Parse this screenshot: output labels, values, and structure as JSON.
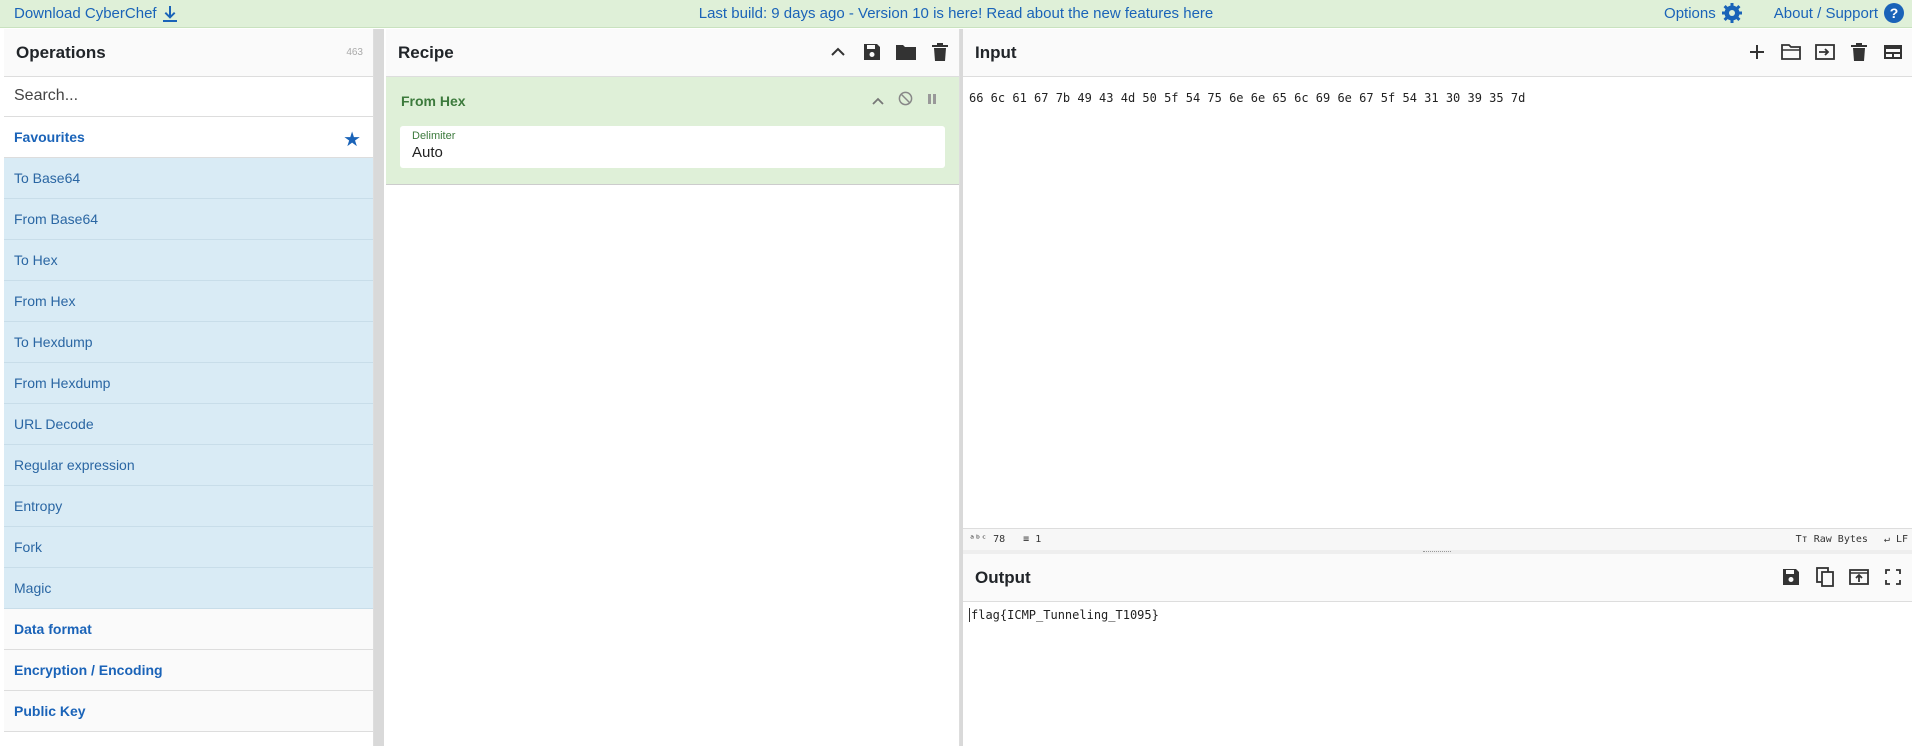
{
  "banner": {
    "download": "Download CyberChef",
    "build": "Last build: 9 days ago - Version 10 is here! Read about the new features here",
    "options": "Options",
    "about": "About / Support"
  },
  "operations": {
    "title": "Operations",
    "count": "463",
    "search_placeholder": "Search...",
    "favourites": "Favourites",
    "items": [
      "To Base64",
      "From Base64",
      "To Hex",
      "From Hex",
      "To Hexdump",
      "From Hexdump",
      "URL Decode",
      "Regular expression",
      "Entropy",
      "Fork",
      "Magic"
    ],
    "categories": [
      "Data format",
      "Encryption / Encoding",
      "Public Key"
    ]
  },
  "recipe": {
    "title": "Recipe",
    "operation": "From Hex",
    "arg_label": "Delimiter",
    "arg_value": "Auto"
  },
  "input": {
    "title": "Input",
    "text": "66 6c 61 67 7b 49 43 4d 50 5f 54 75 6e 6e 65 6c 69 6e 67 5f 54 31 30 39 35 7d",
    "status_chars": "78",
    "status_lines": "1",
    "encoding": "Raw Bytes",
    "eol": "LF"
  },
  "output": {
    "title": "Output",
    "text": "flag{ICMP_Tunneling_T1095}"
  },
  "colors": {
    "banner_bg": "#dff0d8",
    "link": "#1a63b8",
    "op_bg": "#d9ebf5",
    "recipe_op_bg": "#dff0d8"
  }
}
